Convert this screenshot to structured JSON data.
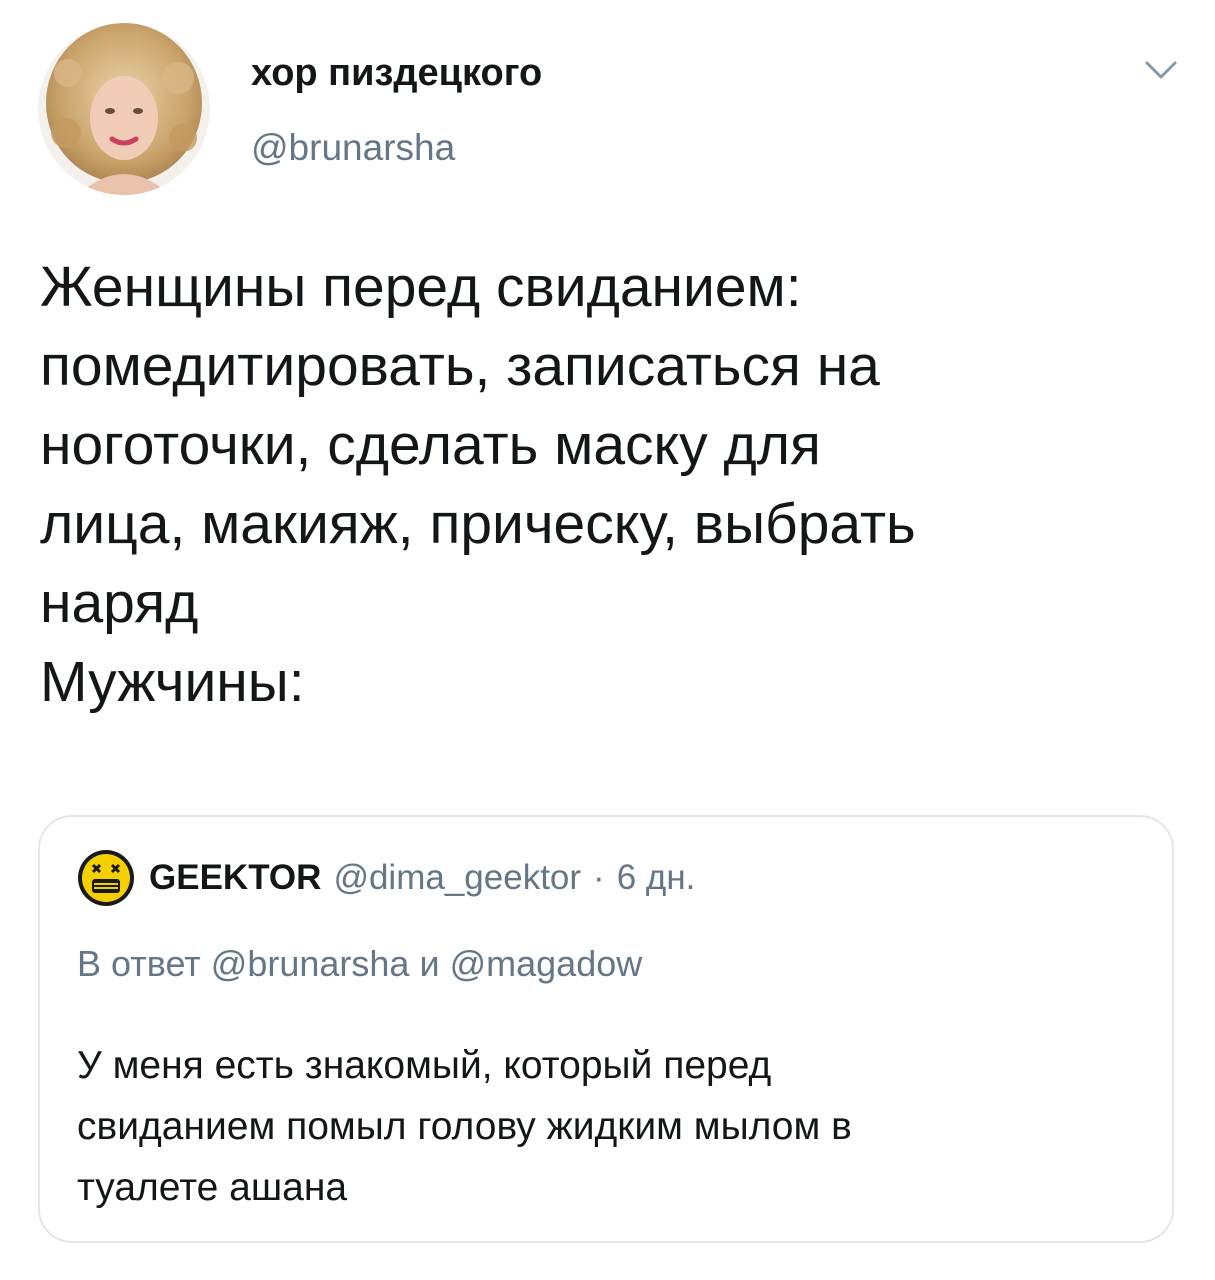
{
  "author": {
    "display_name": "хор пиздецкого",
    "handle": "@brunarsha",
    "avatar_icon": "user-avatar-photo"
  },
  "tweet": {
    "lines": [
      "Женщины перед свиданием:",
      "помедитировать, записаться на",
      "ноготочки, сделать маску для",
      "лица, макияж, прическу, выбрать",
      "наряд",
      "Мужчины:"
    ]
  },
  "quoted_tweet": {
    "display_name": "GEEKTOR",
    "handle": "@dima_geektor",
    "separator": "·",
    "time": "6 дн.",
    "avatar_icon": "geektor-emoji-avatar",
    "reply_prefix": "В ответ",
    "reply_mention_1": "@brunarsha",
    "reply_conjunction": "и",
    "reply_mention_2": "@magadow",
    "lines": [
      "У меня есть знакомый, который перед",
      "свиданием помыл голову жидким мылом в",
      "туалете ашана"
    ]
  },
  "colors": {
    "text_primary": "#14171a",
    "text_secondary": "#657786",
    "border": "#e1e8ed",
    "avatar_badge": "#f5d000"
  }
}
